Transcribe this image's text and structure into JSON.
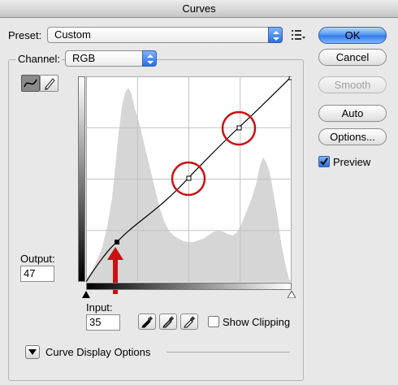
{
  "window": {
    "title": "Curves"
  },
  "preset": {
    "label": "Preset:",
    "value": "Custom"
  },
  "channel": {
    "label": "Channel:",
    "value": "RGB"
  },
  "buttons": {
    "ok": "OK",
    "cancel": "Cancel",
    "smooth": "Smooth",
    "auto": "Auto",
    "options": "Options..."
  },
  "preview": {
    "label": "Preview",
    "checked": true
  },
  "output": {
    "label": "Output:",
    "value": "47"
  },
  "input": {
    "label": "Input:",
    "value": "35"
  },
  "show_clipping": {
    "label": "Show Clipping",
    "checked": false
  },
  "curve_display": {
    "label": "Curve Display Options"
  },
  "tools": {
    "curve_tool_icon": "curve-point-icon",
    "pencil_tool_icon": "pencil-icon",
    "eyedroppers": [
      "black-eyedropper-icon",
      "gray-eyedropper-icon",
      "white-eyedropper-icon"
    ]
  },
  "accent_colors": {
    "annotation": "#cc1111",
    "default_button": "#2f78e8"
  }
}
